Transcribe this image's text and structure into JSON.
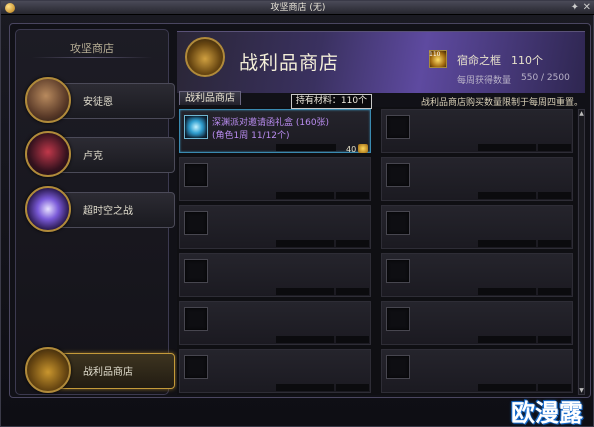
{
  "window": {
    "title": "攻坚商店 (无)",
    "pin_glyph": "✦",
    "close_glyph": "✕"
  },
  "sidebar": {
    "header": "攻坚商店",
    "items": [
      {
        "label": "安徒恩",
        "portrait": "anton-portrait"
      },
      {
        "label": "卢克",
        "portrait": "luke-portrait"
      },
      {
        "label": "超时空之战",
        "portrait": "time-space-portrait"
      }
    ],
    "active_item": {
      "label": "战利品商店",
      "portrait": "loot-chest-portrait"
    }
  },
  "banner": {
    "title": "战利品商店",
    "currency": {
      "badge": "110",
      "name": "宿命之框",
      "amount": "110个"
    },
    "weekly": {
      "label": "每周获得数量",
      "value": "550 / 2500"
    }
  },
  "notice": "战利品商店购买数量限制于每周四重置。",
  "tab": {
    "label": "战利品商店"
  },
  "tooltip": {
    "text": "持有材料：110个"
  },
  "items": [
    {
      "name": "深渊派对邀请函礼盒 (160张)",
      "sub": "(角色1周 11/12个)",
      "price": "40"
    }
  ],
  "watermark": "欧漫露",
  "colors": {
    "accent_gold": "#b08a3a",
    "item_rare_purple": "#b98cf0",
    "banner_purple": "#5e4aa0",
    "selection_blue": "#3a8ab0"
  },
  "icons": {
    "currency": "fate-frame-icon",
    "price": "coin-icon"
  }
}
